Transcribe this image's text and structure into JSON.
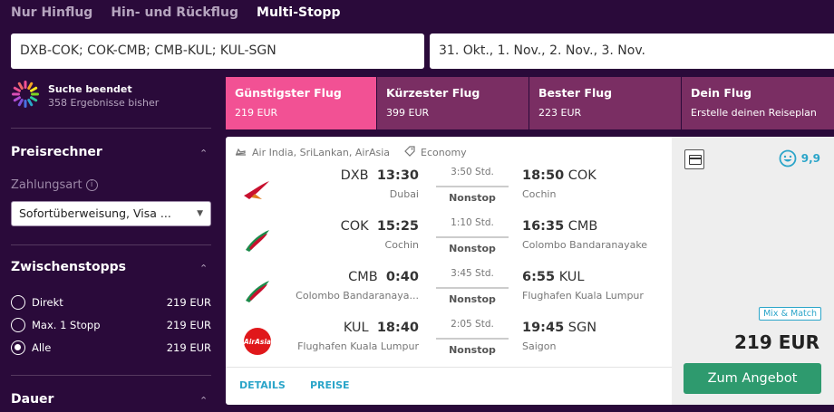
{
  "trip_tabs": {
    "one_way": "Nur Hinflug",
    "round_trip": "Hin- und Rückflug",
    "multi_stop": "Multi-Stopp"
  },
  "search": {
    "route": "DXB-COK; COK-CMB; CMB-KUL; KUL-SGN",
    "dates": "31. Okt., 1. Nov., 2. Nov., 3. Nov."
  },
  "status": {
    "title": "Suche beendet",
    "subtitle": "358 Ergebnisse bisher"
  },
  "price_calc": {
    "title": "Preisrechner",
    "payment_label": "Zahlungsart",
    "payment_value": "Sofortüberweisung, Visa ..."
  },
  "stops": {
    "title": "Zwischenstopps",
    "options": [
      {
        "label": "Direkt",
        "price": "219 EUR",
        "checked": false
      },
      {
        "label": "Max. 1 Stopp",
        "price": "219 EUR",
        "checked": false
      },
      {
        "label": "Alle",
        "price": "219 EUR",
        "checked": true
      }
    ]
  },
  "duration": {
    "title": "Dauer"
  },
  "sort_tabs": [
    {
      "title": "Günstigster Flug",
      "sub": "219 EUR",
      "active": true
    },
    {
      "title": "Kürzester Flug",
      "sub": "399 EUR",
      "active": false
    },
    {
      "title": "Bester Flug",
      "sub": "223 EUR",
      "active": false
    },
    {
      "title": "Dein Flug",
      "sub": "Erstelle deinen Reiseplan",
      "active": false
    }
  ],
  "result": {
    "airlines": "Air India, SriLankan, AirAsia",
    "cabin": "Economy",
    "legs": [
      {
        "airline": "Air India",
        "dep_code": "DXB",
        "dep_time": "13:30",
        "dep_city": "Dubai",
        "duration": "3:50 Std.",
        "stops": "Nonstop",
        "arr_time": "18:50",
        "arr_code": "COK",
        "arr_city": "Cochin"
      },
      {
        "airline": "SriLankan",
        "dep_code": "COK",
        "dep_time": "15:25",
        "dep_city": "Cochin",
        "duration": "1:10 Std.",
        "stops": "Nonstop",
        "arr_time": "16:35",
        "arr_code": "CMB",
        "arr_city": "Colombo Bandaranayake"
      },
      {
        "airline": "SriLankan",
        "dep_code": "CMB",
        "dep_time": "0:40",
        "dep_city": "Colombo Bandaranaya...",
        "duration": "3:45 Std.",
        "stops": "Nonstop",
        "arr_time": "6:55",
        "arr_code": "KUL",
        "arr_city": "Flughafen Kuala Lumpur"
      },
      {
        "airline": "AirAsia",
        "dep_code": "KUL",
        "dep_time": "18:40",
        "dep_city": "Flughafen Kuala Lumpur",
        "duration": "2:05 Std.",
        "stops": "Nonstop",
        "arr_time": "19:45",
        "arr_code": "SGN",
        "arr_city": "Saigon"
      }
    ],
    "details_link": "DETAILS",
    "prices_link": "PREISE",
    "rating": "9,9",
    "badge": "Mix & Match",
    "price": "219 EUR",
    "cta": "Zum Angebot",
    "airasia_logo_text": "AirAsia"
  },
  "colors": {
    "background": "#2a0a3a",
    "sort_active": "#f25194",
    "sort_inactive": "#7a2e63",
    "link": "#2ba5c9",
    "cta": "#2e9a6e"
  }
}
